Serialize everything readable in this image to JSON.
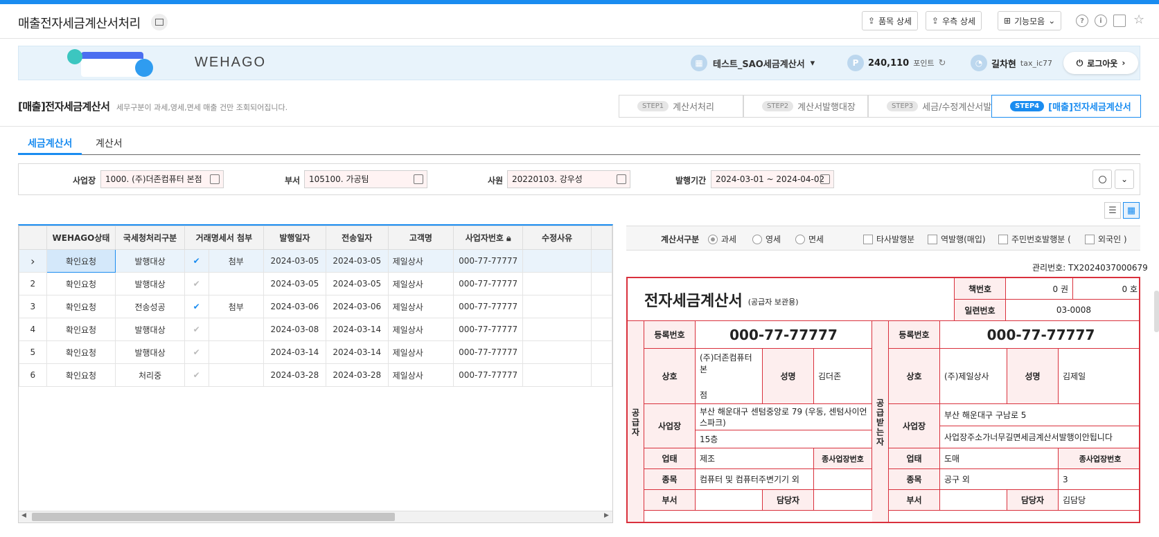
{
  "header": {
    "title": "매출전자세금계산서처리",
    "buttons": [
      "품목 상세",
      "우측 상세",
      "기능모음"
    ]
  },
  "banner": {
    "brand": "WEHAGO",
    "company": "테스트_SAO세금계산서",
    "points": "240,110",
    "points_unit": "포인트",
    "user_name": "길차현",
    "user_id": "tax_ic77",
    "logout": "로그아웃"
  },
  "section": {
    "title": "[매출]전자세금계산서",
    "desc": "세무구분이 과세,영세,면세 매출 건만 조회되어집니다."
  },
  "steps": [
    {
      "badge": "STEP1",
      "label": "계산서처리"
    },
    {
      "badge": "STEP2",
      "label": "계산서발행대장"
    },
    {
      "badge": "STEP3",
      "label": "세금/수정계산서발송"
    },
    {
      "badge": "STEP4",
      "label": "[매출]전자세금계산서"
    }
  ],
  "tabs": [
    "세금계산서",
    "계산서"
  ],
  "filters": {
    "biz_label": "사업장",
    "biz_value": "1000. (주)더존컴퓨터 본점",
    "dept_label": "부서",
    "dept_value": "105100. 가공팀",
    "emp_label": "사원",
    "emp_value": "20220103. 강우성",
    "period_label": "발행기간",
    "period_value": "2024-03-01 ~ 2024-04-02"
  },
  "grid": {
    "columns": [
      "WEHAGO상태",
      "국세청처리구분",
      "거래명세서 첨부",
      "발행일자",
      "전송일자",
      "고객명",
      "사업자번호",
      "수정사유"
    ],
    "rows": [
      {
        "no": "",
        "status": "확인요청",
        "nts": "발행대상",
        "checked": true,
        "attach": "첨부",
        "issue": "2024-03-05",
        "send": "2024-03-05",
        "customer": "제일상사",
        "biz": "000-77-77777",
        "reason": ""
      },
      {
        "no": "2",
        "status": "확인요청",
        "nts": "발행대상",
        "checked": false,
        "attach": "",
        "issue": "2024-03-05",
        "send": "2024-03-05",
        "customer": "제일상사",
        "biz": "000-77-77777",
        "reason": ""
      },
      {
        "no": "3",
        "status": "확인요청",
        "nts": "전송성공",
        "checked": true,
        "attach": "첨부",
        "issue": "2024-03-06",
        "send": "2024-03-06",
        "customer": "제일상사",
        "biz": "000-77-77777",
        "reason": ""
      },
      {
        "no": "4",
        "status": "확인요청",
        "nts": "발행대상",
        "checked": false,
        "attach": "",
        "issue": "2024-03-08",
        "send": "2024-03-14",
        "customer": "제일상사",
        "biz": "000-77-77777",
        "reason": ""
      },
      {
        "no": "5",
        "status": "확인요청",
        "nts": "발행대상",
        "checked": false,
        "attach": "",
        "issue": "2024-03-14",
        "send": "2024-03-14",
        "customer": "제일상사",
        "biz": "000-77-77777",
        "reason": ""
      },
      {
        "no": "6",
        "status": "확인요청",
        "nts": "처리중",
        "checked": false,
        "attach": "",
        "issue": "2024-03-28",
        "send": "2024-03-28",
        "customer": "제일상사",
        "biz": "000-77-77777",
        "reason": ""
      }
    ]
  },
  "options": {
    "label": "계산서구분",
    "radios": [
      "과세",
      "영세",
      "면세"
    ],
    "checks": [
      "타사발행분",
      "역발행(매입)",
      "주민번호발행분 (",
      "외국인 )"
    ]
  },
  "invoice": {
    "mgmt_no": "관리번호: TX2024037000679",
    "title": "전자세금계산서",
    "subtitle": "(공급자 보관용)",
    "book_label": "책번호",
    "book_vol": "0 권",
    "book_no": "0 호",
    "serial_label": "일련번호",
    "serial": "03-0008",
    "supplier_vlabel": "공급자",
    "buyer_vlabel": "공급받는자",
    "lbl_reg": "등록번호",
    "lbl_name": "상호",
    "lbl_rep": "성명",
    "lbl_addr": "사업장",
    "lbl_type": "업태",
    "lbl_subno": "종사업장번호",
    "lbl_item": "종목",
    "lbl_dept": "부서",
    "lbl_mgr": "담당자",
    "s_reg": "000-77-77777",
    "s_name1": "(주)더존컴퓨터 본",
    "s_name2": "점",
    "s_rep": "김더존",
    "s_addr1": "부산 해운대구 센텀중앙로 79 (우동, 센텀사이언스파크)",
    "s_addr2": "15층",
    "s_type": "제조",
    "s_item": "컴퓨터 및 컴퓨터주변기기 외",
    "b_reg": "000-77-77777",
    "b_name": "(주)제일상사",
    "b_rep": "김제일",
    "b_addr1": "부산 해운대구 구남로 5",
    "b_addr2": "사업장주소가너무길면세금계산서발행이안됩니다",
    "b_type": "도매",
    "b_item": "공구 외",
    "b_subno": "3",
    "b_mgr": "김담당"
  }
}
